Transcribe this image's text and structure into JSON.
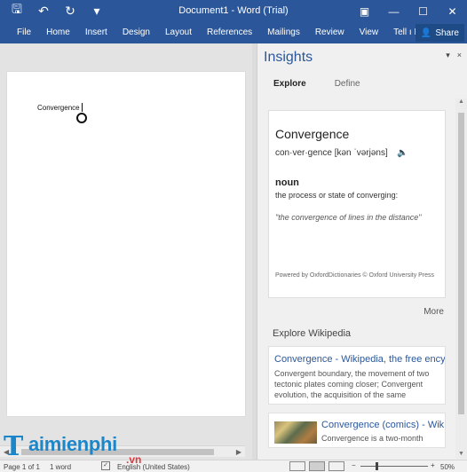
{
  "window": {
    "title": "Document1 - Word (Trial)",
    "qat": [
      {
        "icon": "save-icon",
        "glyph": "🖫"
      },
      {
        "icon": "undo-icon",
        "glyph": "↶"
      },
      {
        "icon": "redo-icon",
        "glyph": "↻"
      },
      {
        "icon": "customize-qat-icon",
        "glyph": "▾"
      }
    ],
    "controls": [
      "▣",
      "—",
      "☐",
      "✕"
    ]
  },
  "ribbon": {
    "tabs": [
      "File",
      "Home",
      "Insert",
      "Design",
      "Layout",
      "References",
      "Mailings",
      "Review",
      "View",
      "♀ Tell me Mani..."
    ],
    "tell_me": "Tell ı Mani...",
    "share": "Share",
    "colors": {
      "accent": "#2b579a"
    }
  },
  "document": {
    "text": "Convergence"
  },
  "insights": {
    "title": "Insights",
    "pane_controls": [
      "▾",
      "×"
    ],
    "tabs": {
      "explore": "Explore",
      "define": "Define"
    },
    "definition": {
      "word": "Convergence",
      "pronunciation": "con·ver·gence [kən ˈvərjəns]",
      "part_of_speech": "noun",
      "meaning": "the process or state of converging:",
      "example": "\"the convergence of lines in the distance\"",
      "source": "Powered by OxfordDictionaries © Oxford University Press"
    },
    "more": "More",
    "wiki_heading": "Explore Wikipedia",
    "wiki_results": [
      {
        "title": "Convergence - Wikipedia, the free ency",
        "snippet": "Convergent boundary, the movement of two tectonic plates coming closer; Convergent evolution, the acquisition of the same"
      },
      {
        "title": "Convergence (comics) - Wik",
        "snippet": "Convergence is a two-month"
      }
    ]
  },
  "statusbar": {
    "page": "Page 1 of 1",
    "words": "1 word",
    "language": "English (United States)",
    "zoom": "50%",
    "zoom_minus": "−",
    "zoom_plus": "+"
  },
  "watermark": {
    "t": "T",
    "rest": "aimienphi",
    "vn": ".vn"
  }
}
